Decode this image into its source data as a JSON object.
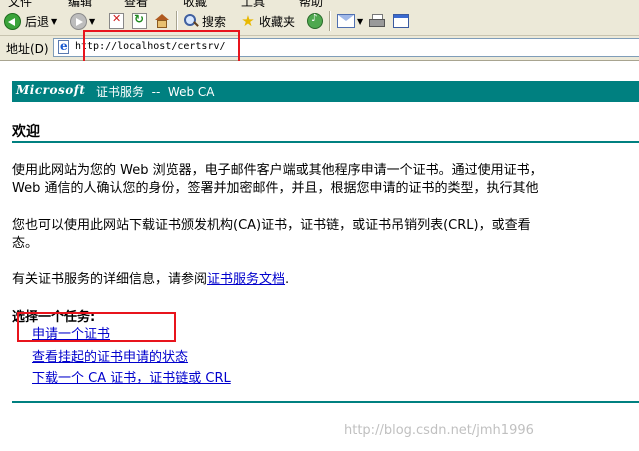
{
  "menu": {
    "items": [
      "文件",
      "编辑",
      "查看",
      "收藏",
      "工具",
      "帮助"
    ]
  },
  "toolbar": {
    "back_label": "后退",
    "search_label": "搜索",
    "favorites_label": "收藏夹",
    "icons": [
      "back-icon",
      "forward-icon",
      "stop-icon",
      "refresh-icon",
      "home-icon",
      "search-icon",
      "favorites-icon",
      "media-icon",
      "mail-icon",
      "print-icon",
      "edit-icon"
    ]
  },
  "address": {
    "label": "地址(D)",
    "url": "http://localhost/certsrv/"
  },
  "page": {
    "brand": "Microsoft",
    "banner_title": "证书服务  --  Web CA",
    "heading": "欢迎",
    "para1_line1": "使用此网站为您的 Web 浏览器，电子邮件客户端或其他程序申请一个证书。通过使用证书，",
    "para1_line2": "Web 通信的人确认您的身份，签署并加密邮件，并且，根据您申请的证书的类型，执行其他",
    "para2_line1": "您也可以使用此网站下载证书颁发机构(CA)证书，证书链，或证书吊销列表(CRL)，或查看",
    "para2_line2": "态。",
    "para3_prefix": "有关证书服务的详细信息，请参阅",
    "para3_link": "证书服务文档",
    "para3_suffix": ".",
    "task_title": "选择一个任务:",
    "tasks": [
      "申请一个证书",
      "查看挂起的证书申请的状态",
      "下载一个 CA 证书，证书链或 CRL"
    ]
  },
  "watermark": "http://blog.csdn.net/jmh1996",
  "colors": {
    "banner": "#008080",
    "highlight": "#e8141c",
    "link": "#0000cc"
  }
}
